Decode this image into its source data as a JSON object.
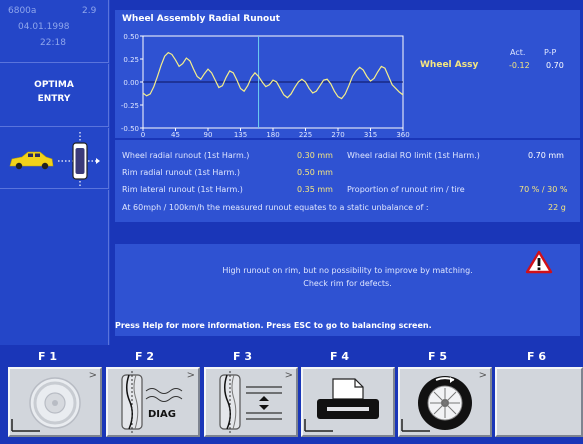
{
  "sidebar": {
    "code": "6800a",
    "version": "2.9",
    "date": "04.01.1998",
    "time": "22:18",
    "mode_line1": "OPTIMA",
    "mode_line2": "ENTRY"
  },
  "chart_data": {
    "type": "line",
    "title": "Wheel Assembly Radial Runout",
    "x_ticks": [
      "0",
      "45",
      "90",
      "135",
      "180",
      "225",
      "270",
      "315",
      "360"
    ],
    "y_ticks": [
      "0.50",
      "0.25",
      "0.00",
      "-0.25",
      "-0.50"
    ],
    "xlim": [
      0,
      360
    ],
    "ylim": [
      -0.5,
      0.5
    ],
    "cursor_x": 160,
    "series": [
      {
        "color": "#f5ee8a",
        "x": [
          0,
          5,
          10,
          15,
          20,
          25,
          30,
          35,
          40,
          45,
          50,
          55,
          60,
          65,
          70,
          75,
          80,
          85,
          90,
          95,
          100,
          105,
          110,
          115,
          120,
          125,
          130,
          135,
          140,
          145,
          150,
          155,
          160,
          165,
          170,
          175,
          180,
          185,
          190,
          195,
          200,
          205,
          210,
          215,
          220,
          225,
          230,
          235,
          240,
          245,
          250,
          255,
          260,
          265,
          270,
          275,
          280,
          285,
          290,
          295,
          300,
          305,
          310,
          315,
          320,
          325,
          330,
          335,
          340,
          345,
          350,
          355,
          360
        ],
        "y": [
          -0.12,
          -0.15,
          -0.13,
          -0.05,
          0.06,
          0.18,
          0.28,
          0.32,
          0.3,
          0.24,
          0.17,
          0.2,
          0.26,
          0.23,
          0.14,
          0.06,
          0.03,
          0.09,
          0.14,
          0.1,
          0.02,
          -0.06,
          -0.04,
          0.05,
          0.12,
          0.1,
          0.02,
          -0.07,
          -0.1,
          -0.04,
          0.05,
          0.1,
          0.06,
          0.0,
          -0.05,
          -0.03,
          0.02,
          0.0,
          -0.07,
          -0.14,
          -0.17,
          -0.13,
          -0.06,
          0.0,
          0.03,
          0.0,
          -0.07,
          -0.12,
          -0.1,
          -0.04,
          0.02,
          0.03,
          -0.02,
          -0.1,
          -0.16,
          -0.18,
          -0.13,
          -0.04,
          0.06,
          0.12,
          0.16,
          0.13,
          0.06,
          0.01,
          0.04,
          0.11,
          0.17,
          0.15,
          0.06,
          -0.03,
          -0.07,
          -0.11,
          -0.14
        ]
      }
    ]
  },
  "chart_summary": {
    "label": "Wheel Assy",
    "act_header": "Act.",
    "pp_header": "P-P",
    "act_value": "-0.12",
    "pp_value": "0.70"
  },
  "info": {
    "row1_label": "Wheel radial runout (1st Harm.)",
    "row1_value": "0.30 mm",
    "row1_label2": "Wheel radial RO limit (1st Harm.)",
    "row1_value2": "0.70 mm",
    "row2_label": "Rim radial runout (1st Harm.)",
    "row2_value": "0.50 mm",
    "row3_label": "Rim lateral runout (1st Harm.)",
    "row3_value": "0.35 mm",
    "row3_label2": "Proportion of runout rim / tire",
    "row3_value2": "70 % / 30 %",
    "row4_label": "At 60mph / 100km/h the measured runout equates to a static unbalance of :",
    "row4_value": "22 g"
  },
  "message": {
    "line1": "High runout on rim, but no possibility to improve by matching.",
    "line2": "Check rim for defects.",
    "help": "Press Help for more information. Press ESC to go to balancing screen."
  },
  "fkeys": {
    "f1": "F 1",
    "f2": "F 2",
    "f3": "F 3",
    "f4": "F 4",
    "f5": "F 5",
    "f6": "F 6",
    "diag": "DIAG",
    "arrow": ">"
  },
  "colors": {
    "background": "#1a36b8",
    "panel": "#2f52d2",
    "curve": "#f5ee8a",
    "cursor": "#6fd0f0",
    "value_text": "#f5e680"
  }
}
